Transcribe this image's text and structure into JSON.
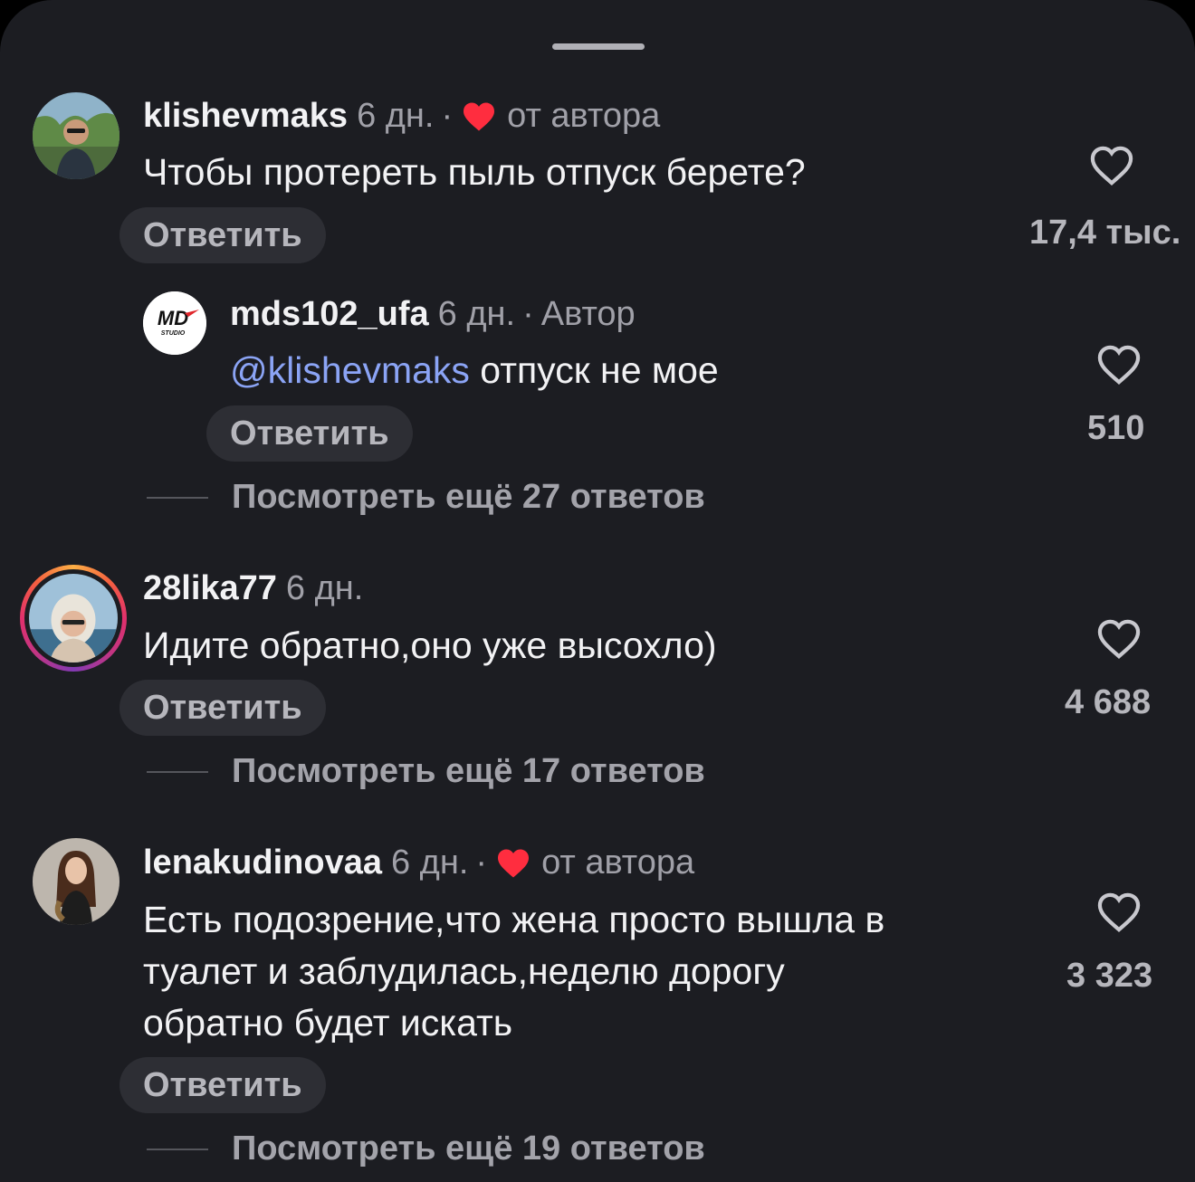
{
  "comments": [
    {
      "username": "klishevmaks",
      "time": "6 дн.",
      "separator": "·",
      "badge": "от автора",
      "text": "Чтобы протереть пыль отпуск берете?",
      "reply_label": "Ответить",
      "likes": "17,4 тыс.",
      "replies": [
        {
          "username": "mds102_ufa",
          "time": "6 дн.",
          "separator": "·",
          "role": "Автор",
          "mention": "@klishevmaks",
          "text": " отпуск не мое",
          "reply_label": "Ответить",
          "likes": "510",
          "avatar_text": "MD",
          "avatar_subtext": "STUDIO"
        }
      ],
      "more_replies": "Посмотреть ещё 27 ответов"
    },
    {
      "username": "28lika77",
      "time": "6 дн.",
      "text": "Идите обратно,оно уже высохло)",
      "reply_label": "Ответить",
      "likes": "4 688",
      "more_replies": "Посмотреть ещё 17 ответов"
    },
    {
      "username": "lenakudinovaa",
      "time": "6 дн.",
      "separator": "·",
      "badge": "от автора",
      "text_lines": [
        "Есть подозрение,что жена просто вышла в",
        "туалет и заблудилась,неделю дорогу",
        "обратно будет искать"
      ],
      "reply_label": "Ответить",
      "likes": "3 323",
      "more_replies": "Посмотреть ещё 19 ответов"
    }
  ],
  "icons": {
    "like": "heart-outline-icon",
    "author_liked": "heart-filled-icon"
  },
  "colors": {
    "background": "#1c1d22",
    "mention": "#8ba4f5",
    "author_heart": "#ff2d3f"
  }
}
